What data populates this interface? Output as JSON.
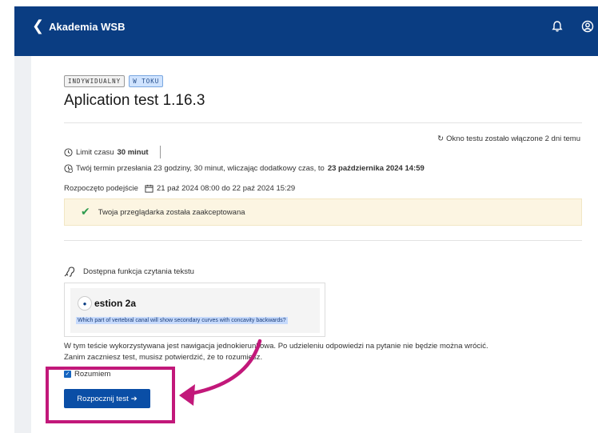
{
  "header": {
    "back_label": "Akademia WSB"
  },
  "badges": [
    "INDYWIDUALNY",
    "W TOKU"
  ],
  "page_title": "Aplication test 1.16.3",
  "open_info": "Okno testu zostało włączone 2 dni temu",
  "time_limit": {
    "label": "Limit czasu",
    "value": "30 minut"
  },
  "deadline": {
    "text": "Twój termin przesłania 23 godziny, 30 minut, wliczając dodatkowy czas, to",
    "date": "23 października 2024 14:59"
  },
  "attempt": {
    "label": "Rozpoczęto podejście",
    "range": "21 paź 2024 08:00 do 22 paź 2024 15:29"
  },
  "browser_accepted": "Twoja przeglądarka została zaakceptowana",
  "tts_label": "Dostępna funkcja czytania tekstu",
  "preview": {
    "question_title": "estion 2a",
    "question_text": "Which part of vertebral canal will show secondary curves with concavity backwards?"
  },
  "nav_note_line1": "W tym teście wykorzystywana jest nawigacja jednokierunkowa. Po udzieleniu odpowiedzi na pytanie nie będzie można wrócić.",
  "nav_note_line2": "Zanim zaczniesz test, musisz potwierdzić, że to rozumiesz.",
  "understand_label": "Rozumiem",
  "understand_checked": true,
  "start_button": "Rozpocznij test",
  "colors": {
    "header": "#0a3d82",
    "accent": "#0a4ea6",
    "highlight": "#c2187a",
    "success": "#2e9b4f"
  }
}
